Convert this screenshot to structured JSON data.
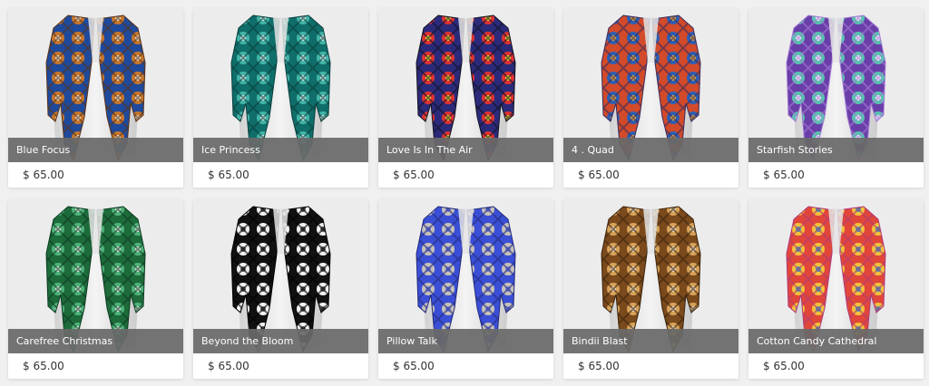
{
  "products": [
    {
      "title": "Blue Focus",
      "price": "$ 65.00",
      "colors": [
        "#1f4a9c",
        "#c9772a",
        "#f3e7d2",
        "#5a3217"
      ]
    },
    {
      "title": "Ice Princess",
      "price": "$ 65.00",
      "colors": [
        "#0f6e6a",
        "#43b5a8",
        "#d9f0ee",
        "#0a3d3c"
      ]
    },
    {
      "title": "Love Is In The Air",
      "price": "$ 65.00",
      "colors": [
        "#2b2a7a",
        "#e03232",
        "#f4e23a",
        "#111122"
      ]
    },
    {
      "title": "4 . Quad",
      "price": "$ 65.00",
      "colors": [
        "#d24a2a",
        "#2e5fb3",
        "#e8b23a",
        "#3a2a5a"
      ]
    },
    {
      "title": "Starfish Stories",
      "price": "$ 65.00",
      "colors": [
        "#6a3ea8",
        "#58c2b0",
        "#f4f4f8",
        "#a47ad6"
      ]
    },
    {
      "title": "Carefree Christmas",
      "price": "$ 65.00",
      "colors": [
        "#1d6b3a",
        "#4fb37a",
        "#e6f1e6",
        "#0d3a22"
      ]
    },
    {
      "title": "Beyond the Bloom",
      "price": "$ 65.00",
      "colors": [
        "#111111",
        "#f2f2f2",
        "#5a5a5a",
        "#000000"
      ]
    },
    {
      "title": "Pillow Talk",
      "price": "$ 65.00",
      "colors": [
        "#3b4fd6",
        "#c7c2b8",
        "#7b86e8",
        "#222a7a"
      ]
    },
    {
      "title": "Bindii Blast",
      "price": "$ 65.00",
      "colors": [
        "#7a4a1c",
        "#d9a35a",
        "#f1e0c2",
        "#3a220c"
      ]
    },
    {
      "title": "Cotton Candy Cathedral",
      "price": "$ 65.00",
      "colors": [
        "#e0463a",
        "#f4c23a",
        "#3aa0b0",
        "#b03a7a"
      ]
    }
  ]
}
